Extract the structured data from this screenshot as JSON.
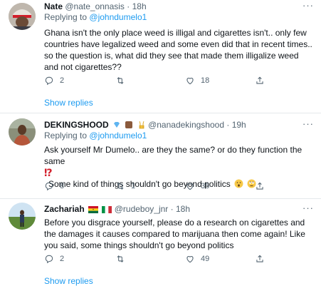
{
  "tweets": [
    {
      "name": "Nate",
      "handle": "@nate_onnasis",
      "sep": "·",
      "time": "18h",
      "replying_prefix": "Replying to",
      "replying_to": "@johndumelo1",
      "text": "Ghana isn't the only place weed is illigal and cigarettes isn't.. only few countries have legalized weed and some even did that in recent times.. so the question is, what did they see that made them illigalize weed and not cigarettes??",
      "reply_count": "2",
      "retweet_count": "",
      "like_count": "18",
      "show_replies": "Show replies"
    },
    {
      "name": "DEKINGSHOOD",
      "handle": "@nanadekingshood",
      "sep": "·",
      "time": "19h",
      "replying_prefix": "Replying to",
      "replying_to": "@johndumelo1",
      "text_line1": "Ask yourself Mr Dumelo.. are they the same? or do they function the same",
      "text_line2_mark": "⁉",
      "text_line3": "Some kind of things shouldn't go beyond politics",
      "reply_count": "8",
      "retweet_count": "1",
      "like_count": "35"
    },
    {
      "name": "Zachariah",
      "handle": "@rudeboy_jnr",
      "sep": "·",
      "time": "18h",
      "text": "Before you disgrace yourself, please do a research on cigarettes and the damages it causes compared to marijuana then come again! Like you said, some things shouldn't go beyond politics",
      "reply_count": "2",
      "retweet_count": "",
      "like_count": "49",
      "show_replies": "Show replies"
    }
  ],
  "colors": {
    "link": "#1d9bf0",
    "secondary": "#536471",
    "text": "#0f1419"
  },
  "icons": [
    "more-icon",
    "reply-icon",
    "retweet-icon",
    "like-icon",
    "share-icon"
  ]
}
